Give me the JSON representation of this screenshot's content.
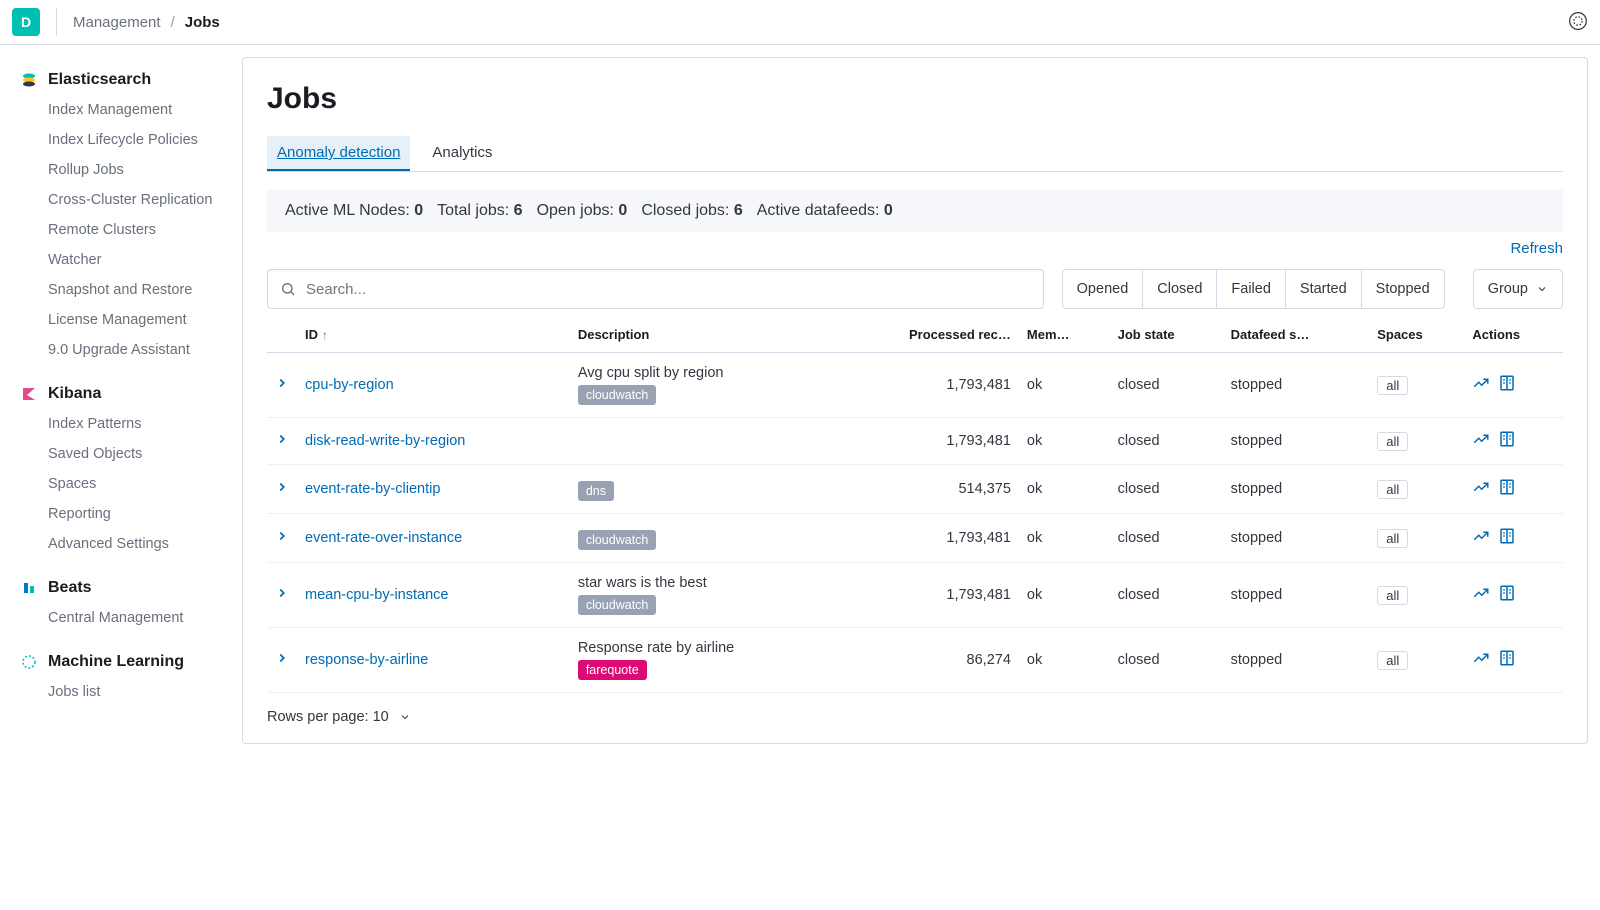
{
  "topbar": {
    "app_letter": "D",
    "breadcrumb": {
      "parent": "Management",
      "current": "Jobs"
    }
  },
  "sidebar": {
    "groups": [
      {
        "title": "Elasticsearch",
        "items": [
          "Index Management",
          "Index Lifecycle Policies",
          "Rollup Jobs",
          "Cross-Cluster Replication",
          "Remote Clusters",
          "Watcher",
          "Snapshot and Restore",
          "License Management",
          "9.0 Upgrade Assistant"
        ]
      },
      {
        "title": "Kibana",
        "items": [
          "Index Patterns",
          "Saved Objects",
          "Spaces",
          "Reporting",
          "Advanced Settings"
        ]
      },
      {
        "title": "Beats",
        "items": [
          "Central Management"
        ]
      },
      {
        "title": "Machine Learning",
        "items": [
          "Jobs list"
        ]
      }
    ]
  },
  "page": {
    "title": "Jobs",
    "tabs": [
      {
        "label": "Anomaly detection",
        "selected": true
      },
      {
        "label": "Analytics",
        "selected": false
      }
    ],
    "stats": {
      "active_ml_nodes_label": "Active ML Nodes:",
      "active_ml_nodes": "0",
      "total_jobs_label": "Total jobs:",
      "total_jobs": "6",
      "open_jobs_label": "Open jobs:",
      "open_jobs": "0",
      "closed_jobs_label": "Closed jobs:",
      "closed_jobs": "6",
      "active_datafeeds_label": "Active datafeeds:",
      "active_datafeeds": "0"
    },
    "refresh_label": "Refresh",
    "search_placeholder": "Search...",
    "filters": [
      "Opened",
      "Closed",
      "Failed",
      "Started",
      "Stopped"
    ],
    "group_label": "Group",
    "columns": {
      "id": "ID",
      "description": "Description",
      "processed": "Processed rec…",
      "memory": "Mem…",
      "job_state": "Job state",
      "datafeed": "Datafeed s…",
      "spaces": "Spaces",
      "actions": "Actions"
    },
    "rows": [
      {
        "id": "cpu-by-region",
        "desc": "Avg cpu split by region",
        "tag": "cloudwatch",
        "tag_pink": false,
        "processed": "1,793,481",
        "memory": "ok",
        "state": "closed",
        "datafeed": "stopped",
        "spaces": "all"
      },
      {
        "id": "disk-read-write-by-region",
        "desc": "",
        "tag": "",
        "tag_pink": false,
        "processed": "1,793,481",
        "memory": "ok",
        "state": "closed",
        "datafeed": "stopped",
        "spaces": "all"
      },
      {
        "id": "event-rate-by-clientip",
        "desc": "",
        "tag": "dns",
        "tag_pink": false,
        "processed": "514,375",
        "memory": "ok",
        "state": "closed",
        "datafeed": "stopped",
        "spaces": "all"
      },
      {
        "id": "event-rate-over-instance",
        "desc": "",
        "tag": "cloudwatch",
        "tag_pink": false,
        "processed": "1,793,481",
        "memory": "ok",
        "state": "closed",
        "datafeed": "stopped",
        "spaces": "all"
      },
      {
        "id": "mean-cpu-by-instance",
        "desc": "star wars is the best",
        "tag": "cloudwatch",
        "tag_pink": false,
        "processed": "1,793,481",
        "memory": "ok",
        "state": "closed",
        "datafeed": "stopped",
        "spaces": "all"
      },
      {
        "id": "response-by-airline",
        "desc": "Response rate by airline",
        "tag": "farequote",
        "tag_pink": true,
        "processed": "86,274",
        "memory": "ok",
        "state": "closed",
        "datafeed": "stopped",
        "spaces": "all"
      }
    ],
    "rows_per_page_label": "Rows per page: 10"
  }
}
